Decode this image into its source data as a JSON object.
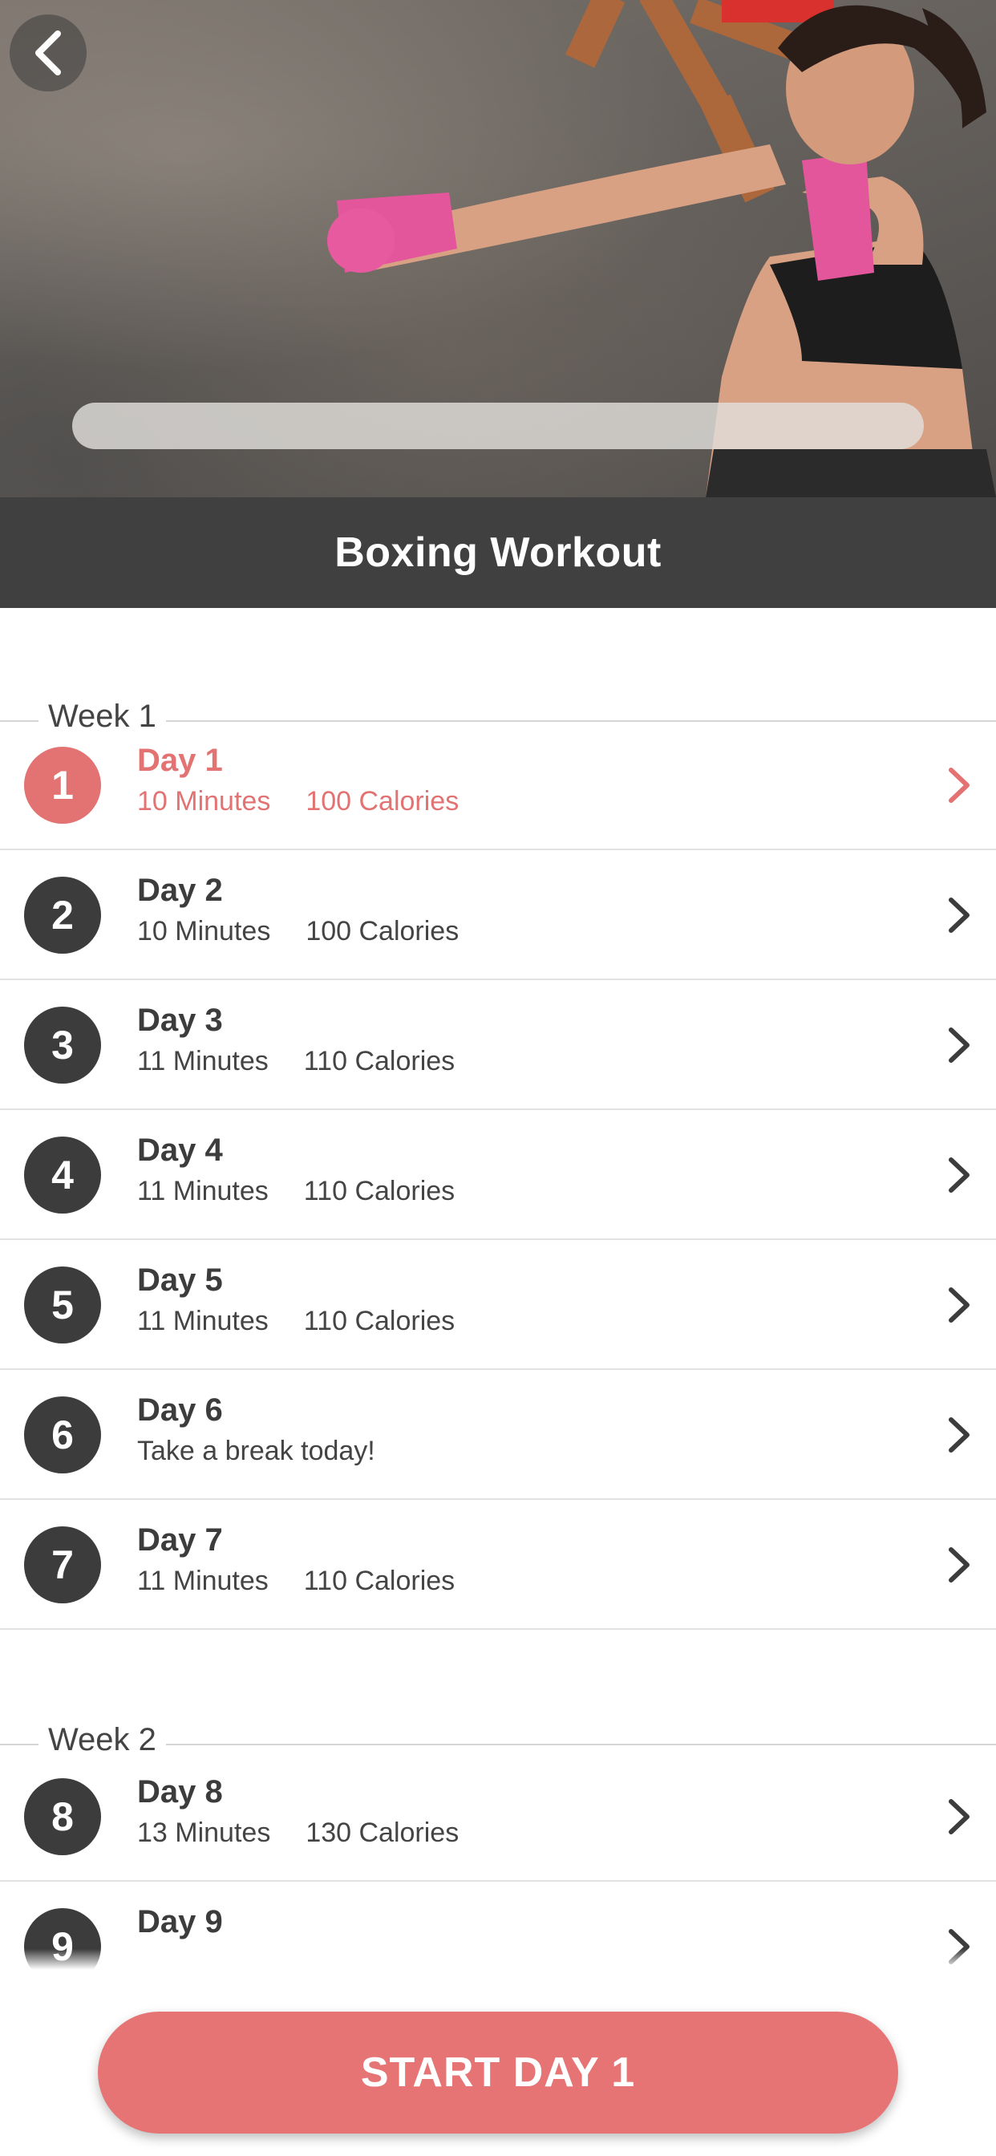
{
  "header": {
    "title": "Boxing Workout",
    "back_icon": "chevron-left-icon",
    "progress_fraction": 0.0
  },
  "weeks": [
    {
      "label": "Week 1",
      "days": [
        {
          "num": "1",
          "title": "Day 1",
          "minutes": "10 Minutes",
          "calories": "100 Calories",
          "active": true
        },
        {
          "num": "2",
          "title": "Day 2",
          "minutes": "10 Minutes",
          "calories": "100 Calories"
        },
        {
          "num": "3",
          "title": "Day 3",
          "minutes": "11 Minutes",
          "calories": "110 Calories"
        },
        {
          "num": "4",
          "title": "Day 4",
          "minutes": "11 Minutes",
          "calories": "110 Calories"
        },
        {
          "num": "5",
          "title": "Day 5",
          "minutes": "11 Minutes",
          "calories": "110 Calories"
        },
        {
          "num": "6",
          "title": "Day 6",
          "note": "Take a break today!"
        },
        {
          "num": "7",
          "title": "Day 7",
          "minutes": "11 Minutes",
          "calories": "110 Calories"
        }
      ]
    },
    {
      "label": "Week 2",
      "days": [
        {
          "num": "8",
          "title": "Day 8",
          "minutes": "13 Minutes",
          "calories": "130 Calories"
        },
        {
          "num": "9",
          "title": "Day 9",
          "minutes": "",
          "calories": ""
        }
      ]
    }
  ],
  "cta": {
    "label": "START DAY 1"
  },
  "colors": {
    "accent": "#e37272",
    "button": "#e67474",
    "title_bar": "#404040",
    "badge": "#3c3c3c"
  }
}
